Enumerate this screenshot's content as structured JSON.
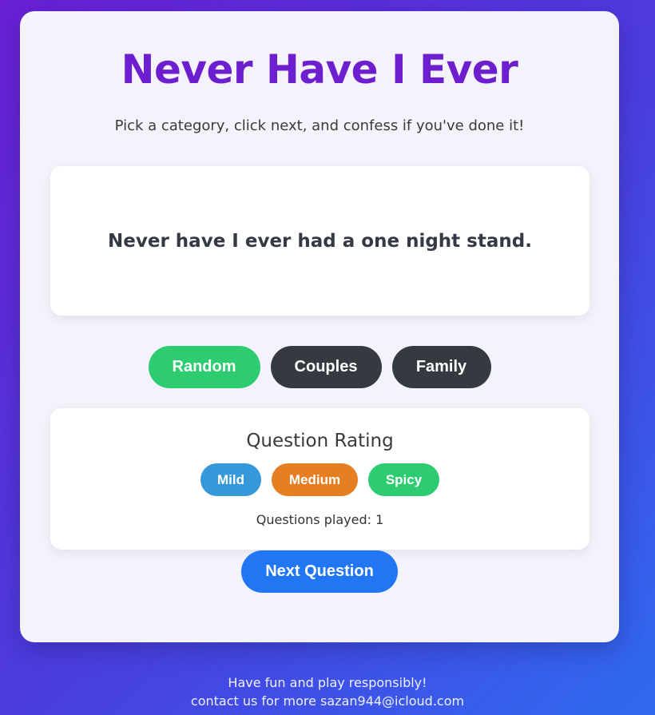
{
  "game": {
    "title": "Never Have I Ever",
    "subtitle": "Pick a category, click next, and confess if you've done it!",
    "question": "Never have I ever had a one night stand."
  },
  "categories": [
    {
      "label": "Random",
      "color": "#2ecc71"
    },
    {
      "label": "Couples",
      "color": "#343a40"
    },
    {
      "label": "Family",
      "color": "#343a40"
    }
  ],
  "rating": {
    "title": "Question Rating",
    "options": [
      {
        "label": "Mild",
        "color": "#3498db"
      },
      {
        "label": "Medium",
        "color": "#e67e22"
      },
      {
        "label": "Spicy",
        "color": "#2ecc71"
      }
    ],
    "played_text": "Questions played: 1"
  },
  "actions": {
    "next_label": "Next Question",
    "next_color": "#2176f3"
  },
  "footer": {
    "line1": "Have fun and play responsibly!",
    "line2": "contact us for more sazan944@icloud.com"
  },
  "theme": {
    "title_color": "#6d1ecf",
    "background_gradient": [
      "#6a1fd6",
      "#2f6af0"
    ]
  }
}
